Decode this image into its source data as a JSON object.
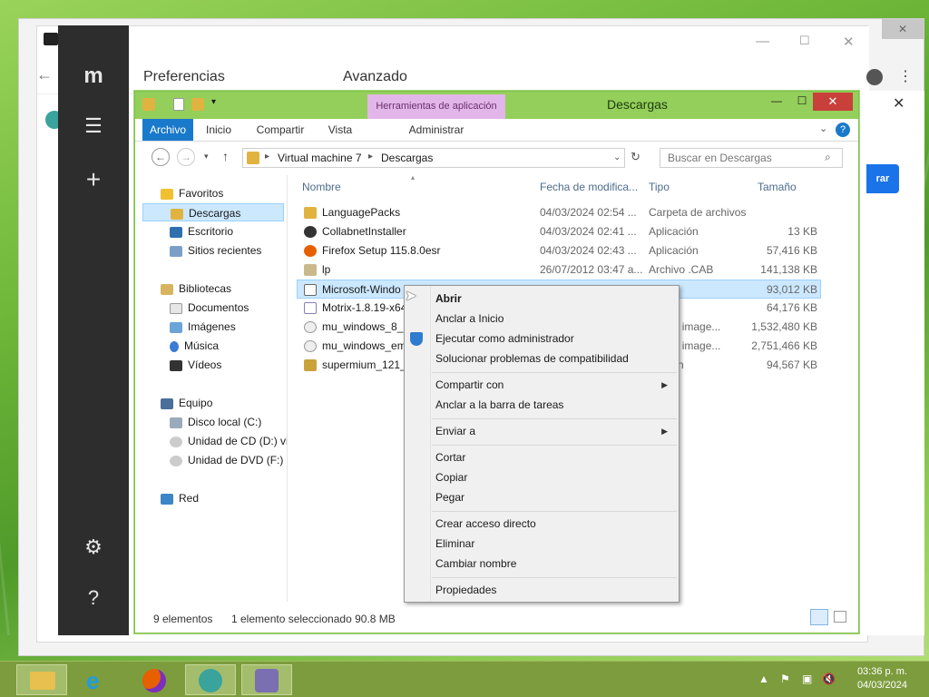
{
  "motrix": {
    "preferences_title": "Preferencias",
    "advanced_title": "Avanzado"
  },
  "explorer": {
    "title": "Descargas",
    "tools_tab": "Herramientas de aplicación",
    "ribbon_tabs": [
      "Archivo",
      "Inicio",
      "Compartir",
      "Vista",
      "Administrar"
    ],
    "address": [
      "Virtual machine 7",
      "Descargas"
    ],
    "search_placeholder": "Buscar en Descargas",
    "columns": [
      "Nombre",
      "Fecha de modifica...",
      "Tipo",
      "Tamaño"
    ],
    "nav": {
      "favorites": "Favoritos",
      "downloads": "Descargas",
      "desktop": "Escritorio",
      "recent": "Sitios recientes",
      "libraries": "Bibliotecas",
      "documents": "Documentos",
      "images": "Imágenes",
      "music": "Música",
      "videos": "Vídeos",
      "computer": "Equipo",
      "local_disk": "Disco local (C:)",
      "cd_drive": "Unidad de CD (D:) vi",
      "dvd_drive": "Unidad de DVD (F:) I",
      "network": "Red"
    },
    "files": [
      {
        "name": "LanguagePacks",
        "date": "04/03/2024 02:54 ...",
        "type": "Carpeta de archivos",
        "size": ""
      },
      {
        "name": "CollabnetInstaller",
        "date": "04/03/2024 02:41 ...",
        "type": "Aplicación",
        "size": "13 KB"
      },
      {
        "name": "Firefox Setup 115.8.0esr",
        "date": "04/03/2024 02:43 ...",
        "type": "Aplicación",
        "size": "57,416 KB"
      },
      {
        "name": "lp",
        "date": "26/07/2012 03:47 a...",
        "type": "Archivo .CAB",
        "size": "141,138 KB"
      },
      {
        "name": "Microsoft-Windo",
        "date": "",
        "type": "",
        "size": "93,012 KB"
      },
      {
        "name": "Motrix-1.8.19-x64",
        "date": "",
        "type": "",
        "size": "64,176 KB"
      },
      {
        "name": "mu_windows_8_la",
        "date": "",
        "type": "o de image...",
        "size": "1,532,480 KB"
      },
      {
        "name": "mu_windows_em",
        "date": "",
        "type": "o de image...",
        "size": "2,751,466 KB"
      },
      {
        "name": "supermium_121_",
        "date": "",
        "type": "ación",
        "size": "94,567 KB"
      }
    ],
    "status_count": "9 elementos",
    "status_selection": "1 elemento seleccionado  90.8 MB"
  },
  "context_menu": {
    "open": "Abrir",
    "pin_start": "Anclar a Inicio",
    "run_admin": "Ejecutar como administrador",
    "troubleshoot": "Solucionar problemas de compatibilidad",
    "share_with": "Compartir con",
    "pin_taskbar": "Anclar a la barra de tareas",
    "send_to": "Enviar a",
    "cut": "Cortar",
    "copy": "Copiar",
    "paste": "Pegar",
    "create_shortcut": "Crear acceso directo",
    "delete": "Eliminar",
    "rename": "Cambiar nombre",
    "properties": "Propiedades"
  },
  "background": {
    "button_fragment": "rar"
  },
  "taskbar": {
    "time": "03:36 p. m.",
    "date": "04/03/2024"
  }
}
